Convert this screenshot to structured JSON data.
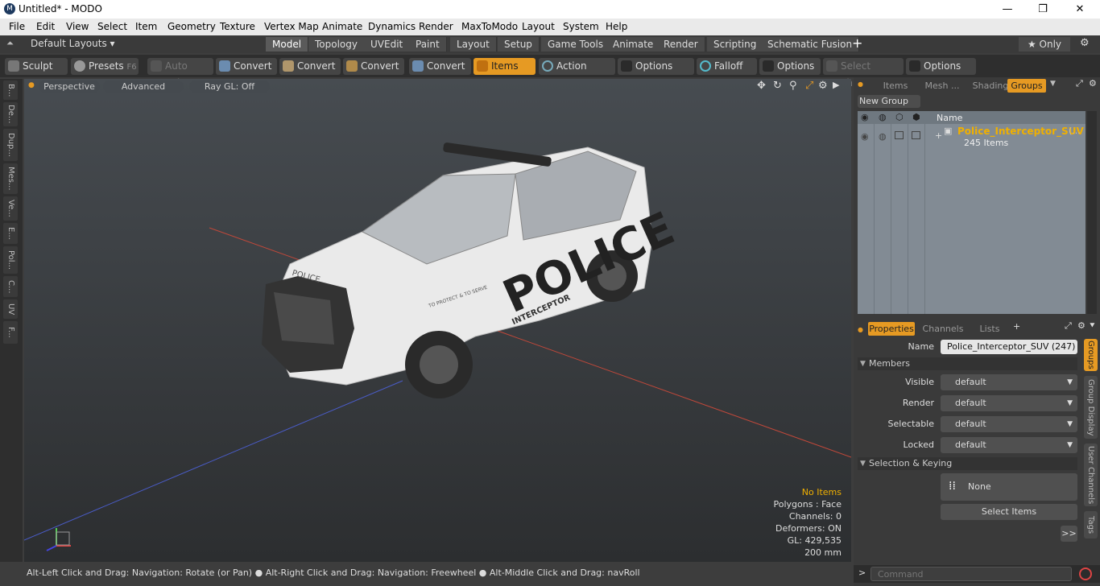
{
  "window": {
    "title": "Untitled* - MODO",
    "logo": "M",
    "min": "—",
    "max": "❐",
    "close": "✕"
  },
  "menu": [
    "File",
    "Edit",
    "View",
    "Select",
    "Item",
    "Geometry",
    "Texture",
    "Vertex Map",
    "Animate",
    "Dynamics",
    "Render",
    "MaxToModo",
    "Layout",
    "System",
    "Help"
  ],
  "layouts": {
    "dropdown": "Default Layouts ▾",
    "tabs": [
      "Model",
      "Topology",
      "UVEdit",
      "Paint",
      "Layout",
      "Setup",
      "Game Tools",
      "Animate",
      "Render",
      "Scripting",
      "Schematic Fusion"
    ],
    "add": "+",
    "only": "★ Only"
  },
  "toolbar": {
    "sculpt": "Sculpt",
    "presets": "Presets",
    "presets_key": "F6",
    "auto_select": "Auto Select",
    "convert1": "Convert",
    "convert2": "Convert",
    "convert3": "Convert",
    "convert4": "Convert",
    "items": "Items",
    "action_center": "Action Center",
    "options1": "Options",
    "falloff": "Falloff",
    "options2": "Options",
    "select_through": "Select Through",
    "options3": "Options"
  },
  "left_tabs": [
    "B...",
    "De...",
    "Dup...",
    "Mes...",
    "Ve...",
    "E...",
    "Pol...",
    "C...",
    "UV",
    "F..."
  ],
  "viewport": {
    "perspective": "Perspective",
    "advanced": "Advanced",
    "raygl": "Ray GL: Off",
    "info": {
      "items": "No Items",
      "polygons": "Polygons : Face",
      "channels": "Channels: 0",
      "deformers": "Deformers: ON",
      "gl": "GL: 429,535",
      "scale": "200 mm"
    },
    "model_text": {
      "hood": "POLICE",
      "side": "POLICE",
      "sub": "INTERCEPTOR",
      "motto": "TO PROTECT & TO SERVE"
    }
  },
  "status": "Alt-Left Click and Drag: Navigation: Rotate (or Pan) ● Alt-Right Click and Drag: Navigation: Freewheel ● Alt-Middle Click and Drag: navRoll",
  "groups_panel": {
    "tabs": [
      "Items",
      "Mesh ...",
      "Shading",
      "Groups"
    ],
    "new_group": "New Group",
    "col_name": "Name",
    "group_name": "Police_Interceptor_SUV",
    "group_more": "(...",
    "group_count": "245 Items"
  },
  "properties": {
    "tabs": [
      "Properties",
      "Channels",
      "Lists"
    ],
    "add": "+",
    "name_label": "Name",
    "name_value": "Police_Interceptor_SUV (247)",
    "members": "Members",
    "visible_label": "Visible",
    "render_label": "Render",
    "selectable_label": "Selectable",
    "locked_label": "Locked",
    "default": "default",
    "sel_keying": "Selection & Keying",
    "none": "None",
    "select_items": "Select Items",
    "more": ">>",
    "side_tabs": [
      "Groups",
      "Group Display",
      "User Channels",
      "Tags"
    ]
  },
  "command": {
    "placeholder": "Command"
  },
  "colors": {
    "accent": "#e69a23",
    "group_text": "#f0b000"
  }
}
